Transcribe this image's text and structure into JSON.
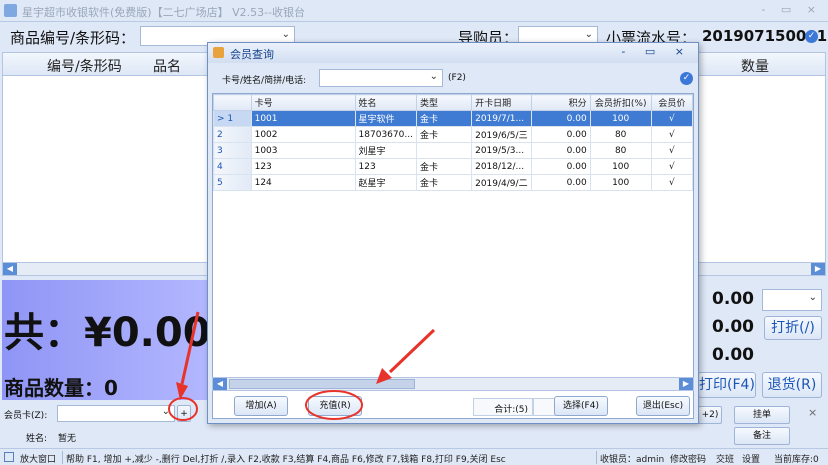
{
  "window": {
    "title": "星宇超市收银软件(免费版)【二七广场店】 V2.53--收银台",
    "controls": "- ▭ ×"
  },
  "toolbar": {
    "product_code_label": "商品编号/条形码：",
    "guide_label": "导购员：",
    "ticket_label": "小票流水号：",
    "ticket_number": "201907150001"
  },
  "main_grid": {
    "columns": [
      "编号/条形码",
      "品名",
      "数量"
    ]
  },
  "totals": {
    "total_text": "共：¥0.00",
    "qty_label": "商品数量：",
    "qty_value": "0",
    "amount1": "0.00",
    "amount2": "0.00",
    "amount3": "0.00",
    "discount_btn": "打折(/)",
    "print_btn": "打印(F4)",
    "return_btn": "退货(R)"
  },
  "member": {
    "card_label": "会员卡(Z):",
    "plus": "+",
    "name_label": "姓名:",
    "name_value": "暂无"
  },
  "side_buttons": {
    "b1": "+2)",
    "hang": "挂单(Ctrl+3)",
    "note": "备注(Ctrl+B)",
    "close": "×"
  },
  "status": {
    "enlarge": "放大窗口",
    "help": "帮助 F1, 增加 +,减少 -,删行 Del,打折 /,录入 F2,收款 F3,结算 F4,商品 F6,修改 F7,钱箱 F8,打印 F9,关闭 Esc",
    "cashier": "收银员：admin",
    "change_pwd": "修改密码",
    "shift": "交班",
    "settings": "设置",
    "stock": "当前库存:0"
  },
  "dialog": {
    "title": "会员查询",
    "controls": "- ▭ ×",
    "search_label": "卡号/姓名/简拼/电话:",
    "search_hint": "(F2)",
    "columns": [
      "卡号",
      "姓名",
      "类型",
      "开卡日期",
      "积分",
      "会员折扣(%)",
      "会员价"
    ],
    "rows": [
      {
        "marker": "> 1",
        "card": "1001",
        "name": "星宇软件",
        "type": "金卡",
        "date": "2019/7/1...",
        "points": "0.00",
        "discount": "100",
        "price": "√"
      },
      {
        "marker": "2",
        "card": "1002",
        "name": "18703670...",
        "type": "金卡",
        "date": "2019/6/5/三",
        "points": "0.00",
        "discount": "80",
        "price": "√"
      },
      {
        "marker": "3",
        "card": "1003",
        "name": "刘星宇",
        "type": "",
        "date": "2019/5/3...",
        "points": "0.00",
        "discount": "80",
        "price": "√"
      },
      {
        "marker": "4",
        "card": "123",
        "name": "123",
        "type": "金卡",
        "date": "2018/12/...",
        "points": "0.00",
        "discount": "100",
        "price": "√"
      },
      {
        "marker": "5",
        "card": "124",
        "name": "赵星宇",
        "type": "金卡",
        "date": "2019/4/9/二",
        "points": "0.00",
        "discount": "100",
        "price": "√"
      }
    ],
    "summary_label": "合计:(5)",
    "summary_value": "0.00",
    "add_btn": "增加(A)",
    "recharge_btn": "充值(R)",
    "select_btn": "选择(F4)",
    "exit_btn": "退出(Esc)"
  },
  "colors": {
    "accent": "#3f7ad3",
    "annotation": "#e8332a",
    "total_panel": "#9ea3fb"
  }
}
